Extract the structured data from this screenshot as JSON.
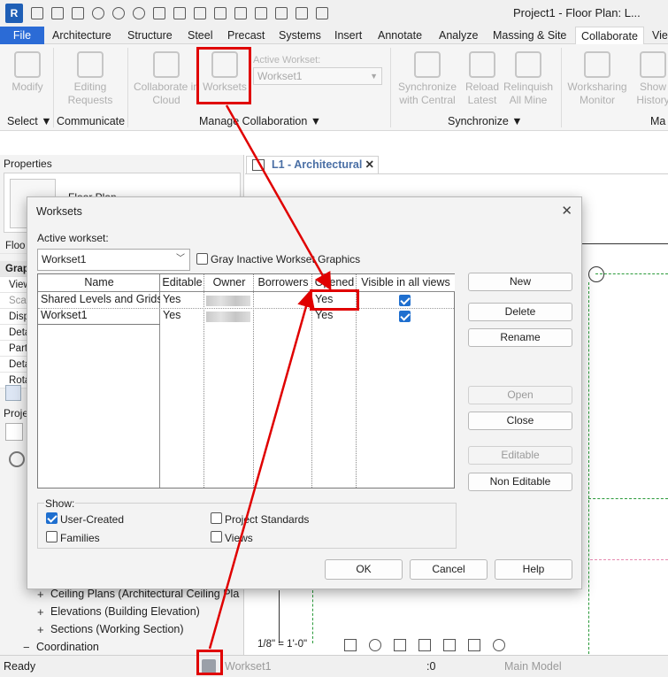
{
  "app": {
    "logo": "R",
    "title": "Project1 - Floor Plan: L..."
  },
  "tabs": [
    {
      "label": "File"
    },
    {
      "label": "Architecture"
    },
    {
      "label": "Structure"
    },
    {
      "label": "Steel"
    },
    {
      "label": "Precast"
    },
    {
      "label": "Systems"
    },
    {
      "label": "Insert"
    },
    {
      "label": "Annotate"
    },
    {
      "label": "Analyze"
    },
    {
      "label": "Massing & Site"
    },
    {
      "label": "Collaborate"
    },
    {
      "label": "View"
    }
  ],
  "ribbon": {
    "modify": "Modify",
    "editing_requests": "Editing Requests",
    "collaborate_in_cloud": "Collaborate in Cloud",
    "worksets": "Worksets",
    "active_workset_label": "Active Workset:",
    "active_workset_value": "Workset1",
    "synchronize_with_central": "Synchronize with Central",
    "reload_latest": "Reload Latest",
    "relinquish_all_mine": "Relinquish All Mine",
    "worksharing_monitor": "Worksharing Monitor",
    "show_history": "Show History",
    "panels": {
      "select": "Select ▼",
      "communicate": "Communicate",
      "manage_collaboration": "Manage Collaboration ▼",
      "synchronize": "Synchronize ▼",
      "manage": "Ma"
    }
  },
  "properties": {
    "title": "Properties",
    "type_name": "Floor Plan",
    "rows": [
      "Floo",
      "Grap",
      "View",
      "Scal",
      "Disp",
      "Deta",
      "Part",
      "Deta",
      "Rota"
    ]
  },
  "project_browser": {
    "title": "Proje",
    "items": [
      {
        "label": "Ceiling Plans (Architectural Ceiling Pla"
      },
      {
        "label": "Elevations (Building Elevation)"
      },
      {
        "label": "Sections (Working Section)"
      },
      {
        "label": "Coordination"
      }
    ]
  },
  "view_tab": {
    "label": "L1 - Architectural",
    "scale": "1/8\" = 1'-0\""
  },
  "status_bar": {
    "ready": "Ready",
    "workset": "Workset1",
    "count": ":0",
    "model": "Main Model"
  },
  "dialog": {
    "title": "Worksets",
    "active_workset_label": "Active workset:",
    "active_workset_value": "Workset1",
    "gray_inactive_label": "Gray Inactive Workset Graphics",
    "gray_inactive_checked": false,
    "columns": [
      "Name",
      "Editable",
      "Owner",
      "Borrowers",
      "Opened",
      "Visible in all views"
    ],
    "rows": [
      {
        "name": "Shared Levels and Grids",
        "editable": "Yes",
        "owner": "",
        "borrowers": "",
        "opened": "Yes",
        "visible": true
      },
      {
        "name": "Workset1",
        "editable": "Yes",
        "owner": "",
        "borrowers": "",
        "opened": "Yes",
        "visible": true
      }
    ],
    "buttons": {
      "new": "New",
      "delete": "Delete",
      "rename": "Rename",
      "open": "Open",
      "close": "Close",
      "editable": "Editable",
      "non_editable": "Non Editable",
      "ok": "OK",
      "cancel": "Cancel",
      "help": "Help"
    },
    "show": {
      "label": "Show:",
      "user_created": {
        "label": "User-Created",
        "checked": true
      },
      "families": {
        "label": "Families",
        "checked": false
      },
      "project_standards": {
        "label": "Project Standards",
        "checked": false
      },
      "views": {
        "label": "Views",
        "checked": false
      }
    }
  },
  "colors": {
    "file_tab": "#2b6bd6",
    "highlight": "#e00000",
    "checkbox": "#1f6fcf",
    "view_tab_text": "#4a6fa5"
  }
}
